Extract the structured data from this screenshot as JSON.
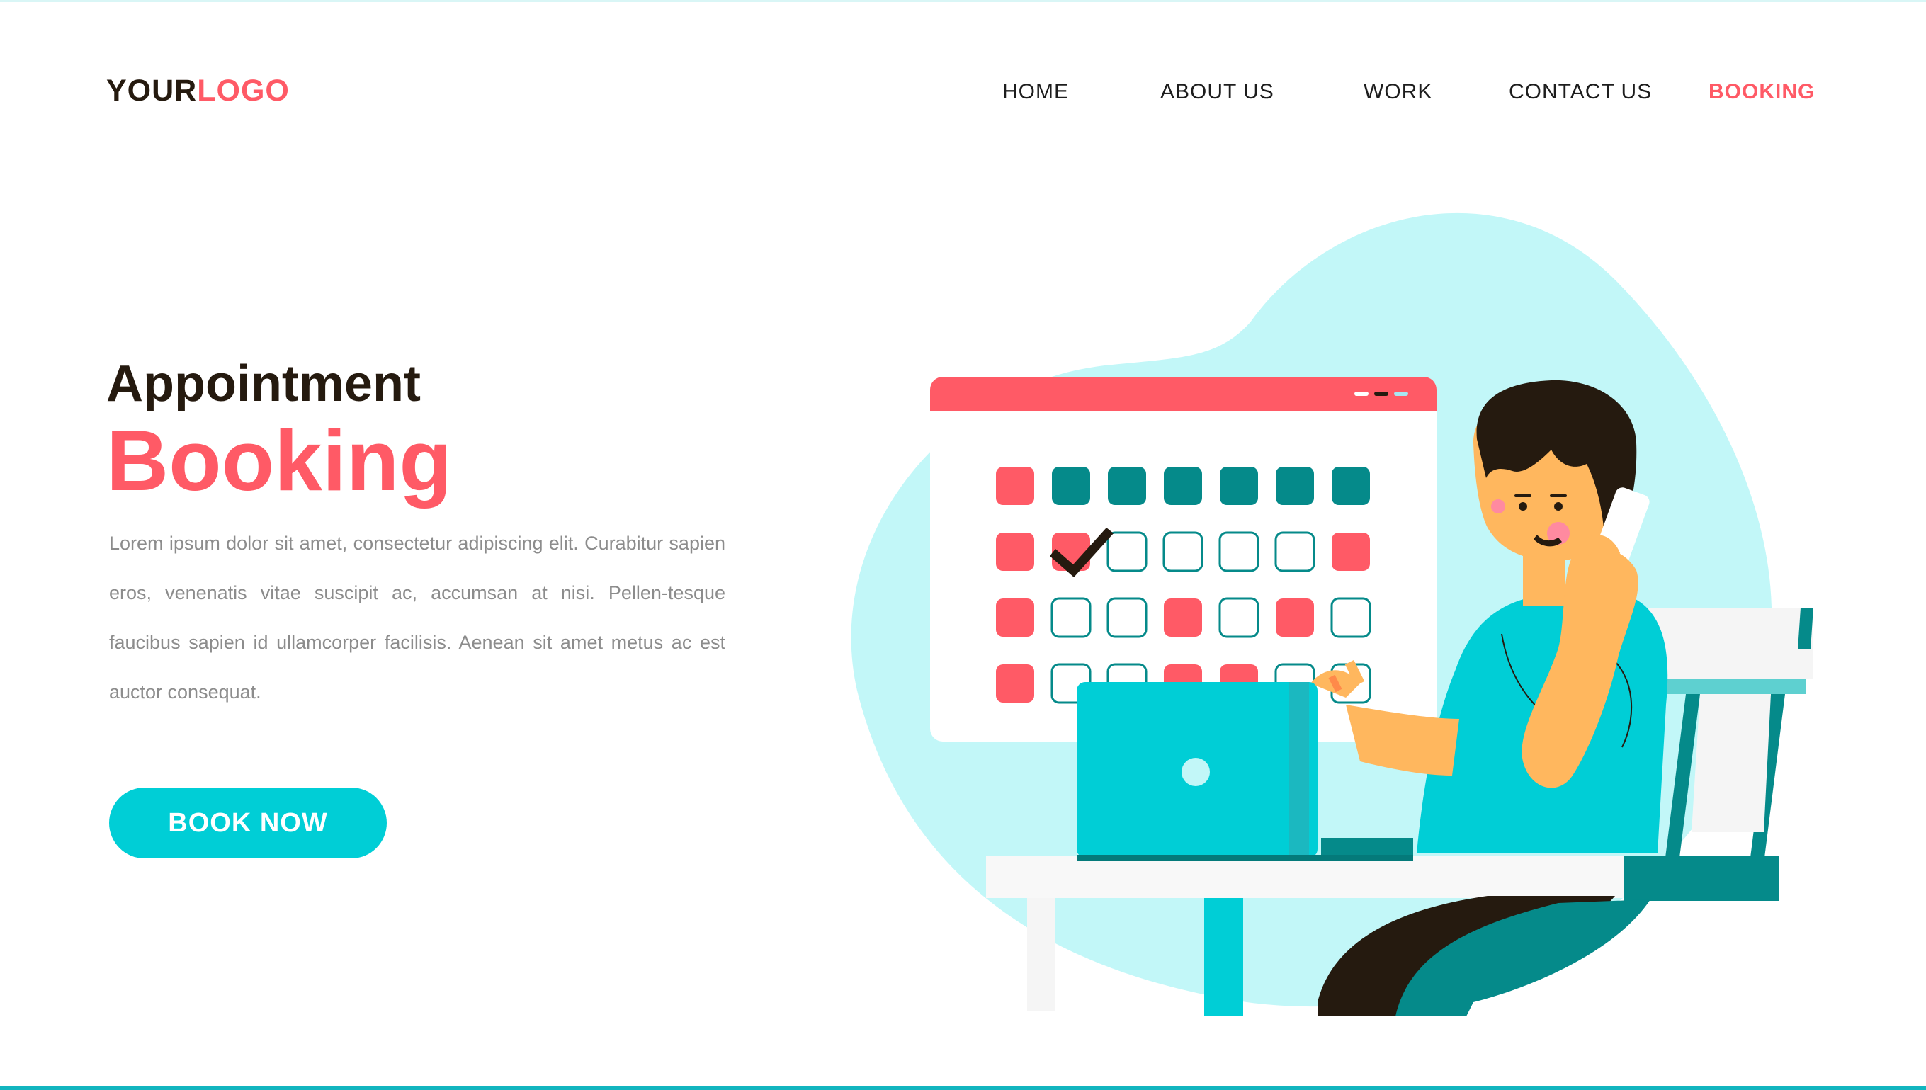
{
  "header": {
    "logo": {
      "part1": "YOUR",
      "part2": "LOGO"
    },
    "nav": [
      {
        "label": "HOME"
      },
      {
        "label": "ABOUT US"
      },
      {
        "label": "WORK"
      },
      {
        "label": "CONTACT US"
      },
      {
        "label": "BOOKING",
        "active": true
      }
    ]
  },
  "hero": {
    "title_line1": "Appointment",
    "title_line2": "Booking",
    "description": "Lorem ipsum dolor sit amet, consectetur adipiscing elit. Curabitur sapien eros, venenatis vitae suscipit ac, accumsan at nisi. Pellen-tesque faucibus sapien id ullamcorper facilisis. Aenean sit amet metus ac est auctor consequat.",
    "cta_label": "BOOK NOW"
  },
  "illustration": {
    "icons": [
      "calendar-window-icon",
      "checkmark-icon",
      "laptop-icon",
      "phone-icon",
      "person-icon",
      "chair-icon",
      "desk-icon"
    ]
  },
  "colors": {
    "accent": "#ff5a66",
    "cta": "#00ced6",
    "dark_text": "#251a0f",
    "body_text": "#8c8c8c",
    "blob": "#c2f7f8",
    "teal_dark": "#058a8a"
  }
}
